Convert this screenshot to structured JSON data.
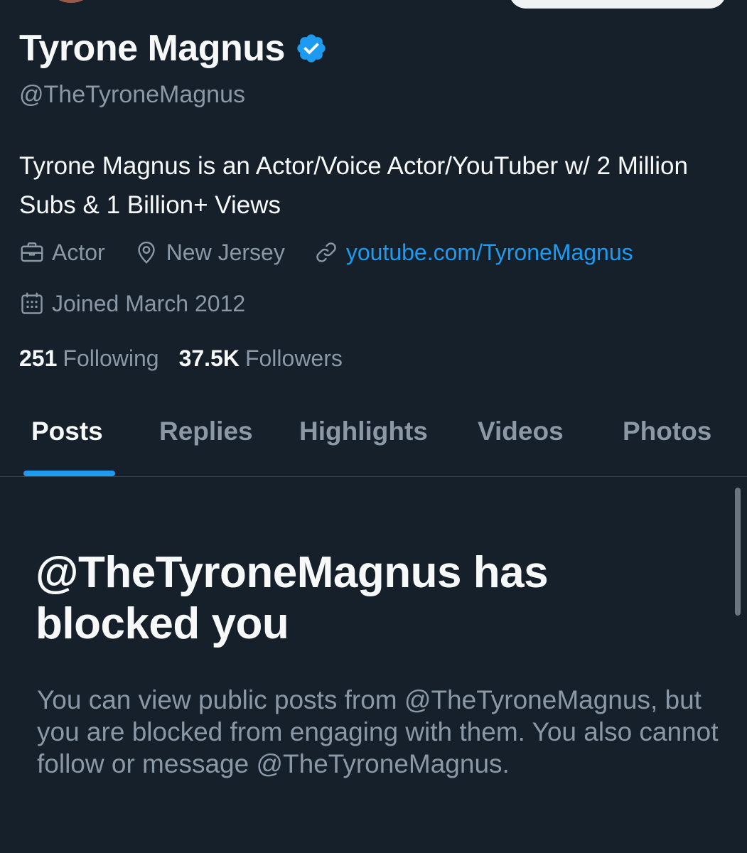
{
  "profile": {
    "display_name": "Tyrone Magnus",
    "handle": "@TheTyroneMagnus",
    "bio": "Tyrone Magnus is an Actor/Voice Actor/YouTuber w/ 2 Million Subs & 1 Billion+ Views",
    "verified_icon": "verified-badge-icon",
    "meta": {
      "profession": "Actor",
      "location": "New Jersey",
      "website": "youtube.com/TyroneMagnus",
      "joined": "Joined March 2012"
    },
    "stats": {
      "following_count": "251",
      "following_label": "Following",
      "followers_count": "37.5K",
      "followers_label": "Followers"
    }
  },
  "tabs": [
    {
      "label": "Posts",
      "active": true
    },
    {
      "label": "Replies",
      "active": false
    },
    {
      "label": "Highlights",
      "active": false
    },
    {
      "label": "Videos",
      "active": false
    },
    {
      "label": "Photos",
      "active": false
    }
  ],
  "blocked_notice": {
    "title": "@TheTyroneMagnus has blocked you",
    "description": "You can view public posts from @TheTyroneMagnus, but you are blocked from engaging with them. You also cannot follow or message @TheTyroneMagnus."
  },
  "colors": {
    "background": "#15202b",
    "accent": "#1d9bf0",
    "secondary_text": "#8b98a5",
    "primary_text": "#f7f9f9"
  }
}
